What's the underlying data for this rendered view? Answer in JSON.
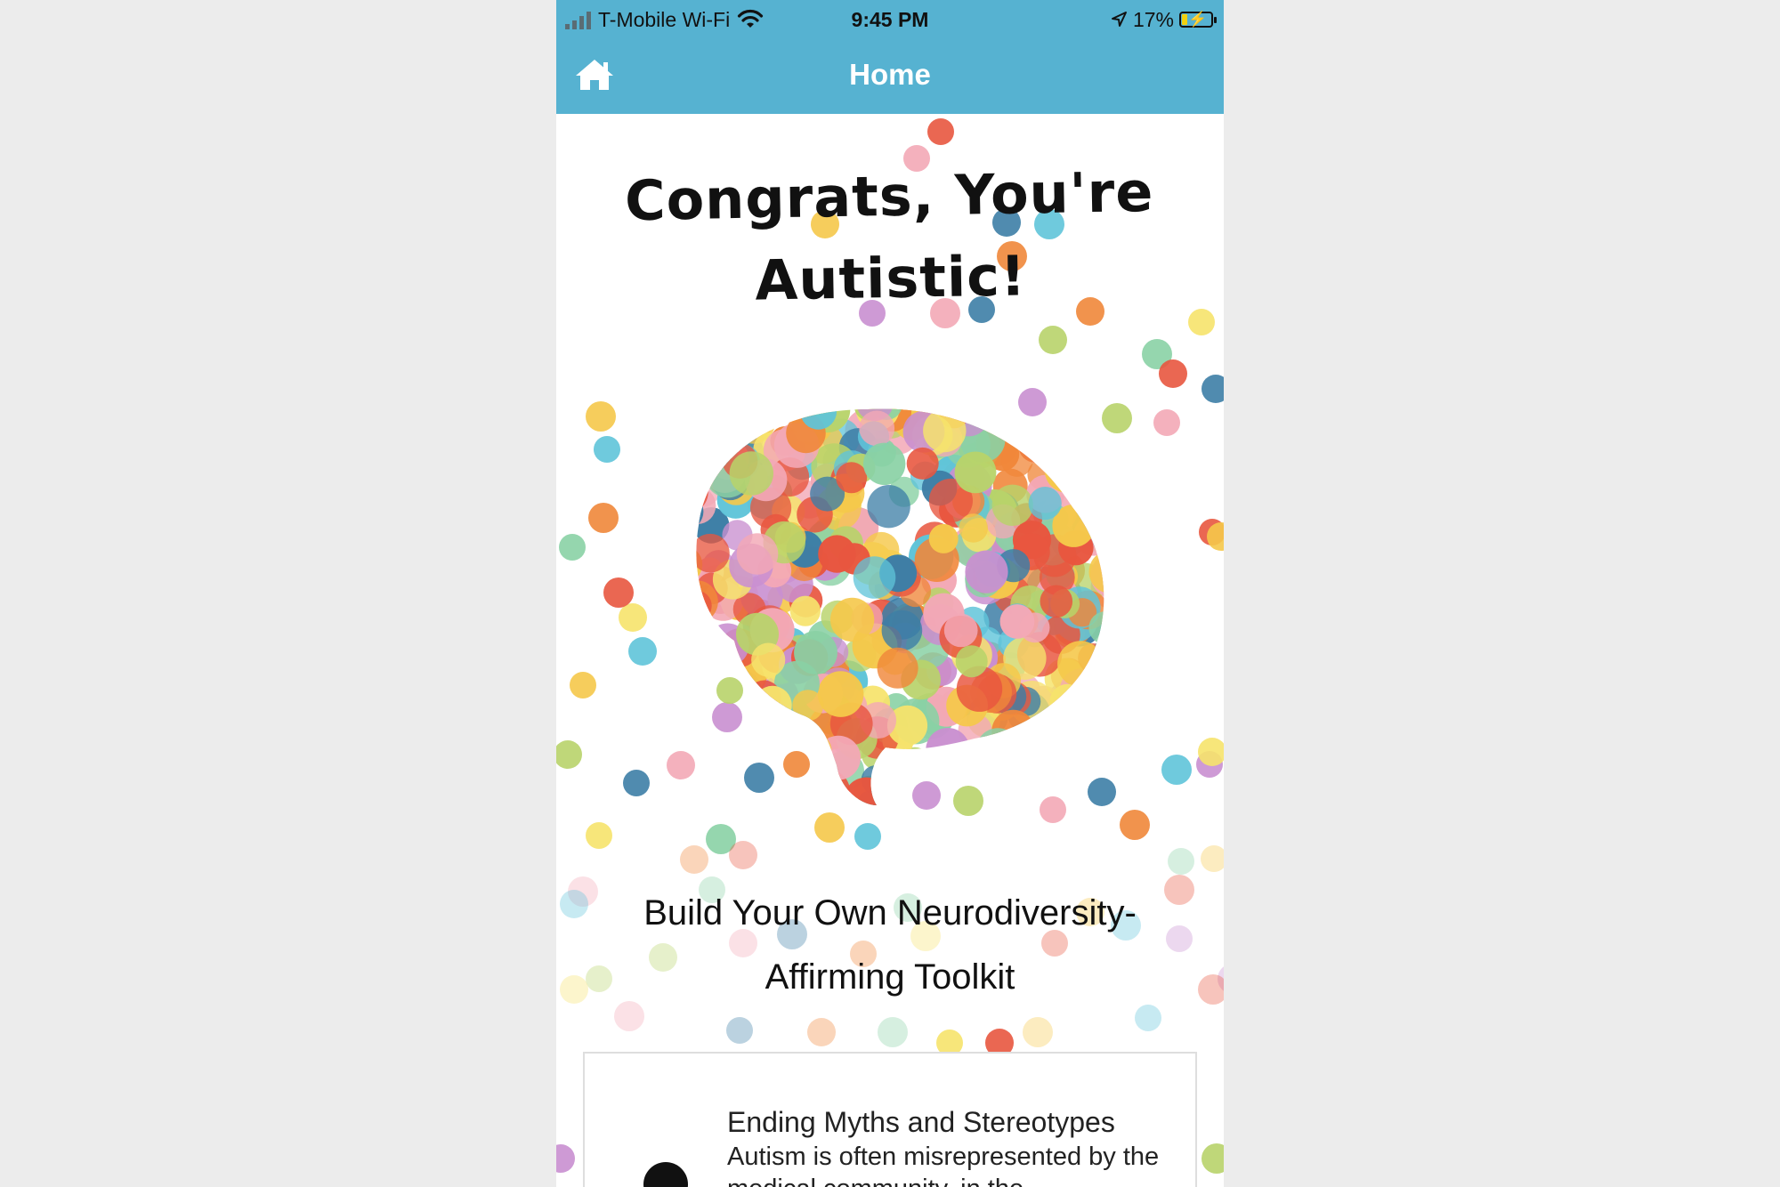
{
  "status_bar": {
    "carrier": "T-Mobile Wi-Fi",
    "time": "9:45 PM",
    "battery": "17%",
    "battery_level": 0.17
  },
  "nav": {
    "title": "Home",
    "home_icon": "home-icon",
    "color": "#56b2d1"
  },
  "hero": {
    "headline_line1": "Congrats, You're",
    "headline_line2": "Autistic!",
    "image_icon": "confetti-brain-illustration"
  },
  "subtitle": {
    "line1": "Build Your Own Neurodiversity-",
    "line2": "Affirming Toolkit"
  },
  "cards": [
    {
      "title": "Ending Myths and Stereotypes",
      "body": "Autism is often misrepresented by the medical community, in the",
      "icon": "brain-icon"
    }
  ],
  "palette": [
    "#e8563f",
    "#f5c84a",
    "#5fc4d9",
    "#c98fd0",
    "#b8d36a",
    "#f3a8b6",
    "#3d7ea6",
    "#f0873a",
    "#8ad1a5",
    "#f6e36c"
  ]
}
